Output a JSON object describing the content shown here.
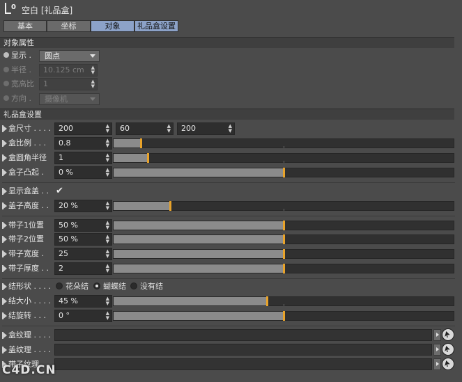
{
  "header": {
    "title": "空白 [礼品盒]"
  },
  "tabs": [
    {
      "label": "基本"
    },
    {
      "label": "坐标"
    },
    {
      "label": "对象"
    },
    {
      "label": "礼品盒设置"
    }
  ],
  "object_section": {
    "title": "对象属性",
    "display": {
      "label": "显示",
      "value": "圆点"
    },
    "radius": {
      "label": "半径",
      "value": "10.125 cm"
    },
    "aspect": {
      "label": "宽高比",
      "value": "1"
    },
    "orientation": {
      "label": "方向",
      "value": "摄像机"
    }
  },
  "gift_section": {
    "title": "礼品盒设置",
    "box_size": {
      "label": "盒尺寸",
      "x": "200",
      "y": "60",
      "z": "200"
    },
    "box_ratio": {
      "label": "盒比例",
      "value": "0.8",
      "fraction": 0.08
    },
    "box_round": {
      "label": "盒圆角半径",
      "value": "1",
      "fraction": 0.1
    },
    "box_bulge": {
      "label": "盒子凸起",
      "value": "0 %",
      "fraction": 0.5
    },
    "show_lid": {
      "label": "显示盒盖",
      "checked": "✔"
    },
    "lid_height": {
      "label": "盖子高度",
      "value": "20 %",
      "fraction": 0.165
    },
    "ribbon1_pos": {
      "label": "带子1位置",
      "value": "50 %",
      "fraction": 0.5
    },
    "ribbon2_pos": {
      "label": "带子2位置",
      "value": "50 %",
      "fraction": 0.5
    },
    "ribbon_width": {
      "label": "带子宽度",
      "value": "25",
      "fraction": 0.5
    },
    "ribbon_thick": {
      "label": "带子厚度",
      "value": "2",
      "fraction": 0.5
    },
    "bow_shape": {
      "label": "结形状",
      "options": [
        "花朵结",
        "蝴蝶结",
        "没有结"
      ],
      "selected": "蝴蝶结"
    },
    "bow_size": {
      "label": "结大小",
      "value": "45 %",
      "fraction": 0.45
    },
    "bow_rotate": {
      "label": "结旋转",
      "value": "0 °",
      "fraction": 0.5
    },
    "box_texture": {
      "label": "盒纹理"
    },
    "lid_texture": {
      "label": "盖纹理"
    },
    "ribbon_texture": {
      "label": "带子纹理"
    }
  },
  "watermark": "C4D.CN",
  "colors": {
    "accent": "#8ca2c8",
    "knob": "#e8a32a",
    "panel": "#4b4b4b"
  }
}
